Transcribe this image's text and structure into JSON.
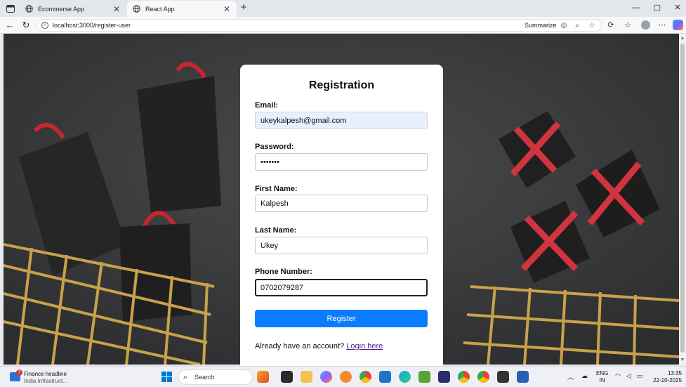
{
  "browser": {
    "tabs": [
      {
        "title": "Ecommerse App",
        "icon": "globe-icon",
        "active": false
      },
      {
        "title": "React App",
        "icon": "globe-icon",
        "active": true
      }
    ],
    "url": "localhost:3000/register-user",
    "summarize_label": "Summarize"
  },
  "form": {
    "title": "Registration",
    "fields": [
      {
        "label": "Email:",
        "value": "ukeykalpesh@gmail.com",
        "type": "email"
      },
      {
        "label": "Password:",
        "value": "1234567",
        "type": "password"
      },
      {
        "label": "First Name:",
        "value": "Kalpesh",
        "type": "text"
      },
      {
        "label": "Last Name:",
        "value": "Ukey",
        "type": "text"
      },
      {
        "label": "Phone Number:",
        "value": "0702079287",
        "type": "text"
      }
    ],
    "submit_label": "Register",
    "login_prompt": "Already have an account?",
    "login_link": "Login here",
    "accent_color": "#0a7cff"
  },
  "taskbar": {
    "news_title": "Finance headline",
    "news_subtitle": "India Infrastruct...",
    "news_badge": "7",
    "search_placeholder": "Search",
    "language": "ENG",
    "region": "IN",
    "time": "13:35",
    "date": "22-10-2025"
  }
}
